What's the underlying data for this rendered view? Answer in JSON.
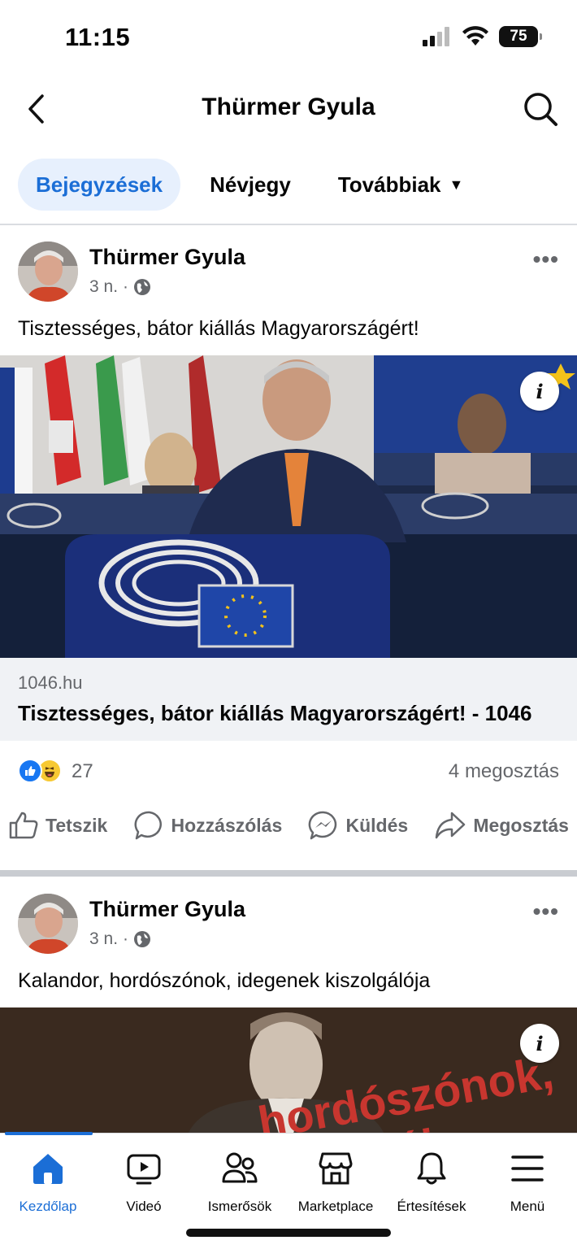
{
  "status": {
    "time": "11:15",
    "battery": "75"
  },
  "header": {
    "title": "Thürmer Gyula"
  },
  "tabs": [
    {
      "label": "Bejegyzések",
      "active": true
    },
    {
      "label": "Névjegy",
      "active": false
    },
    {
      "label": "Továbbiak",
      "active": false
    }
  ],
  "posts": [
    {
      "author": "Thürmer Gyula",
      "time": "3 n.",
      "text": "Tisztességes, bátor kiállás Magyarországért!",
      "link": {
        "domain": "1046.hu",
        "title": "Tisztességes, bátor kiállás Magyarországért! - 1046"
      },
      "reactions_count": "27",
      "shares": "4 megosztás"
    },
    {
      "author": "Thürmer Gyula",
      "time": "3 n.",
      "text": "Kalandor, hordószónok, idegenek kiszolgálója",
      "image_overlay_text": [
        "hordószónok,",
        "lója"
      ]
    }
  ],
  "actions": {
    "like": "Tetszik",
    "comment": "Hozzászólás",
    "send": "Küldés",
    "share": "Megosztás"
  },
  "nav": [
    {
      "label": "Kezdőlap",
      "icon": "home-icon",
      "active": true
    },
    {
      "label": "Videó",
      "icon": "video-icon",
      "active": false
    },
    {
      "label": "Ismerősök",
      "icon": "friends-icon",
      "active": false
    },
    {
      "label": "Marketplace",
      "icon": "marketplace-icon",
      "active": false
    },
    {
      "label": "Értesítések",
      "icon": "bell-icon",
      "active": false
    },
    {
      "label": "Menü",
      "icon": "menu-icon",
      "active": false
    }
  ],
  "colors": {
    "accent": "#1b6ed6",
    "like": "#1877f2",
    "secondary_text": "#65676b"
  }
}
